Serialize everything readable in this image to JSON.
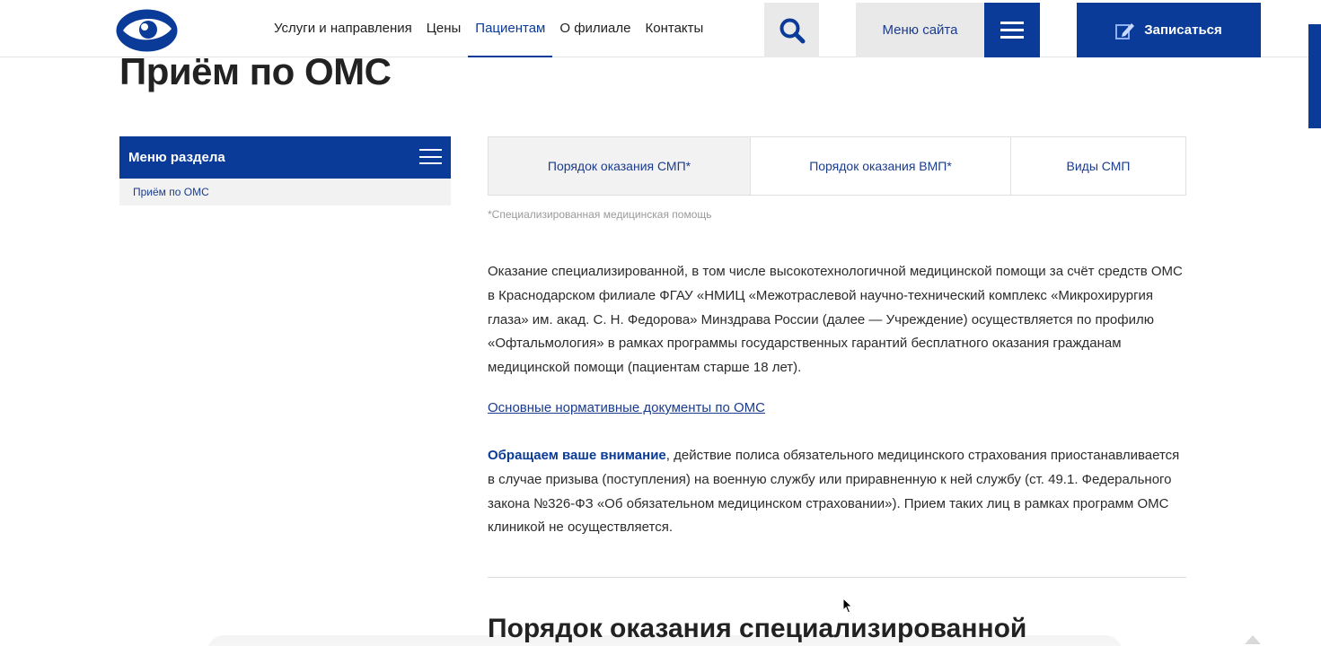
{
  "header": {
    "logo_icon": "eye-logo-icon",
    "nav": [
      {
        "label": "Услуги и направления"
      },
      {
        "label": "Цены"
      },
      {
        "label": "Пациентам",
        "active": true
      },
      {
        "label": "О филиале"
      },
      {
        "label": "Контакты"
      }
    ],
    "search_icon": "search-icon",
    "site_menu_label": "Меню сайта",
    "burger_icon": "hamburger-icon",
    "signup_label": "Записаться",
    "signup_icon": "edit-icon"
  },
  "page": {
    "title": "Приём по ОМС"
  },
  "section_menu": {
    "title": "Меню раздела",
    "items": [
      {
        "label": "Приём по ОМС"
      }
    ]
  },
  "tabs": [
    {
      "label": "Порядок оказания СМП*",
      "active": true
    },
    {
      "label": "Порядок оказания ВМП*"
    },
    {
      "label": "Виды СМП"
    }
  ],
  "footnote": "*Специализированная медицинская помощь",
  "content": {
    "paragraph1": "Оказание специализированной, в том числе высокотехнологичной медицинской помощи за счёт средств ОМС в Краснодарском филиале ФГАУ «НМИЦ «Межотраслевой научно-технический комплекс «Микрохирургия глаза» им. акад. С. Н. Федорова» Минздрава России (далее — Учреждение) осуществляется по профилю «Офтальмология» в рамках программы государственных гарантий бесплатного оказания гражданам медицинской помощи (пациентам старше 18 лет).",
    "documents_link": "Основные нормативные документы по ОМС",
    "attention_bold": "Обращаем ваше внимание",
    "attention_text": ", действие полиса обязательного медицинского страхования приостанавливается в случае призыва (поступления) на военную службу или приравненную к ней службу (ст. 49.1. Федерального закона №326-ФЗ «Об обязательном медицинском страховании»). Прием таких лиц в рамках программ ОМС клиникой не осуществляется.",
    "section_heading": "Порядок оказания специализированной"
  },
  "colors": {
    "brand_blue": "#0a3b99",
    "link_blue": "#1a3c8f",
    "light_gray": "#e9e9e9"
  }
}
